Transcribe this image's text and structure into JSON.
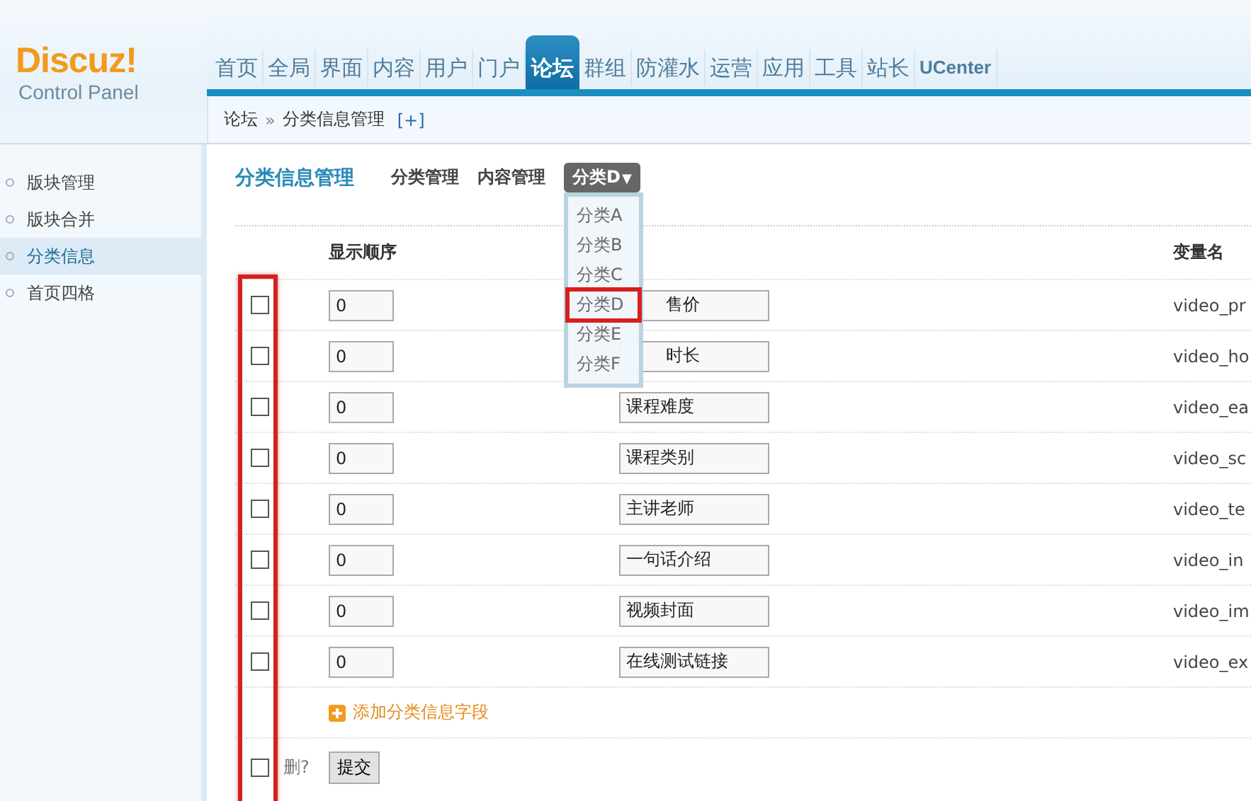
{
  "logo": {
    "title": "Discuz!",
    "subtitle": "Control Panel"
  },
  "nav": [
    {
      "label": "首页",
      "selected": false
    },
    {
      "label": "全局",
      "selected": false
    },
    {
      "label": "界面",
      "selected": false
    },
    {
      "label": "内容",
      "selected": false
    },
    {
      "label": "用户",
      "selected": false
    },
    {
      "label": "门户",
      "selected": false
    },
    {
      "label": "论坛",
      "selected": true
    },
    {
      "label": "群组",
      "selected": false
    },
    {
      "label": "防灌水",
      "selected": false
    },
    {
      "label": "运营",
      "selected": false
    },
    {
      "label": "应用",
      "selected": false
    },
    {
      "label": "工具",
      "selected": false
    },
    {
      "label": "站长",
      "selected": false
    },
    {
      "label": "UCenter",
      "selected": false
    }
  ],
  "breadcrumb": {
    "items": [
      "论坛",
      "分类信息管理"
    ],
    "separator": "»",
    "add": "[+]"
  },
  "sidebar": [
    {
      "label": "版块管理",
      "selected": false
    },
    {
      "label": "版块合并",
      "selected": false
    },
    {
      "label": "分类信息",
      "selected": true
    },
    {
      "label": "首页四格",
      "selected": false
    }
  ],
  "page": {
    "title": "分类信息管理",
    "tabs": [
      "分类管理",
      "内容管理"
    ],
    "dropdown": {
      "label": "分类D",
      "caret": "▼",
      "options": [
        {
          "label": "分类A",
          "selected": false
        },
        {
          "label": "分类B",
          "selected": false
        },
        {
          "label": "分类C",
          "selected": false
        },
        {
          "label": "分类D",
          "selected": true
        },
        {
          "label": "分类E",
          "selected": false
        },
        {
          "label": "分类F",
          "selected": false
        }
      ]
    }
  },
  "table": {
    "order_header": "显示顺序",
    "variable_header": "变量名",
    "checkbox_column_highlighted": true,
    "rows": [
      {
        "checked": false,
        "order": "0",
        "name": "售价",
        "variable": "video_pr"
      },
      {
        "checked": false,
        "order": "0",
        "name": "时长",
        "variable": "video_ho"
      },
      {
        "checked": false,
        "order": "0",
        "name": "课程难度",
        "variable": "video_ea"
      },
      {
        "checked": false,
        "order": "0",
        "name": "课程类别",
        "variable": "video_sc"
      },
      {
        "checked": false,
        "order": "0",
        "name": "主讲老师",
        "variable": "video_te"
      },
      {
        "checked": false,
        "order": "0",
        "name": "一句话介绍",
        "variable": "video_in"
      },
      {
        "checked": false,
        "order": "0",
        "name": "视频封面",
        "variable": "video_im"
      },
      {
        "checked": false,
        "order": "0",
        "name": "在线测试链接",
        "variable": "video_ex"
      }
    ],
    "add_link": "添加分类信息字段",
    "delete_label": "删?",
    "delete_checked": false,
    "submit": "提交"
  }
}
